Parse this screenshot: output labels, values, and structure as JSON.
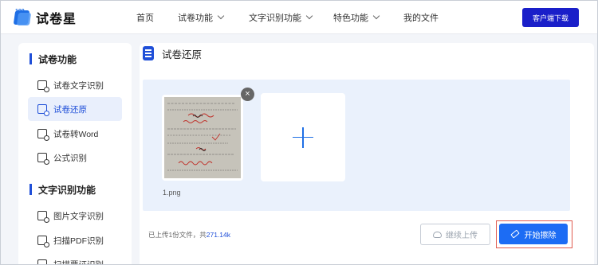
{
  "header": {
    "logo_text": "试卷星",
    "logo_mark_text": "100",
    "nav": [
      {
        "label": "首页",
        "has_dropdown": false
      },
      {
        "label": "试卷功能",
        "has_dropdown": true
      },
      {
        "label": "文字识别功能",
        "has_dropdown": true
      },
      {
        "label": "特色功能",
        "has_dropdown": true
      },
      {
        "label": "我的文件",
        "has_dropdown": false
      }
    ],
    "download_label": "客户端下载"
  },
  "sidebar": {
    "sections": [
      {
        "title": "试卷功能",
        "items": [
          {
            "label": "试卷文字识别",
            "active": false
          },
          {
            "label": "试卷还原",
            "active": true
          },
          {
            "label": "试卷转Word",
            "active": false
          },
          {
            "label": "公式识别",
            "active": false
          }
        ]
      },
      {
        "title": "文字识别功能",
        "items": [
          {
            "label": "图片文字识别",
            "active": false
          },
          {
            "label": "扫描PDF识别",
            "active": false
          },
          {
            "label": "扫描票证识别",
            "active": false
          }
        ]
      }
    ]
  },
  "main": {
    "title": "试卷还原",
    "file": {
      "name": "1.png"
    },
    "status_prefix": "已上传1份文件，共",
    "status_size": "271.14k",
    "continue_label": "继续上传",
    "start_label": "开始擦除"
  },
  "colors": {
    "accent": "#1f4fd8",
    "primary_button": "#1c6cf4",
    "download_button": "#1a1fc9",
    "highlight_border": "#e05a4f"
  }
}
